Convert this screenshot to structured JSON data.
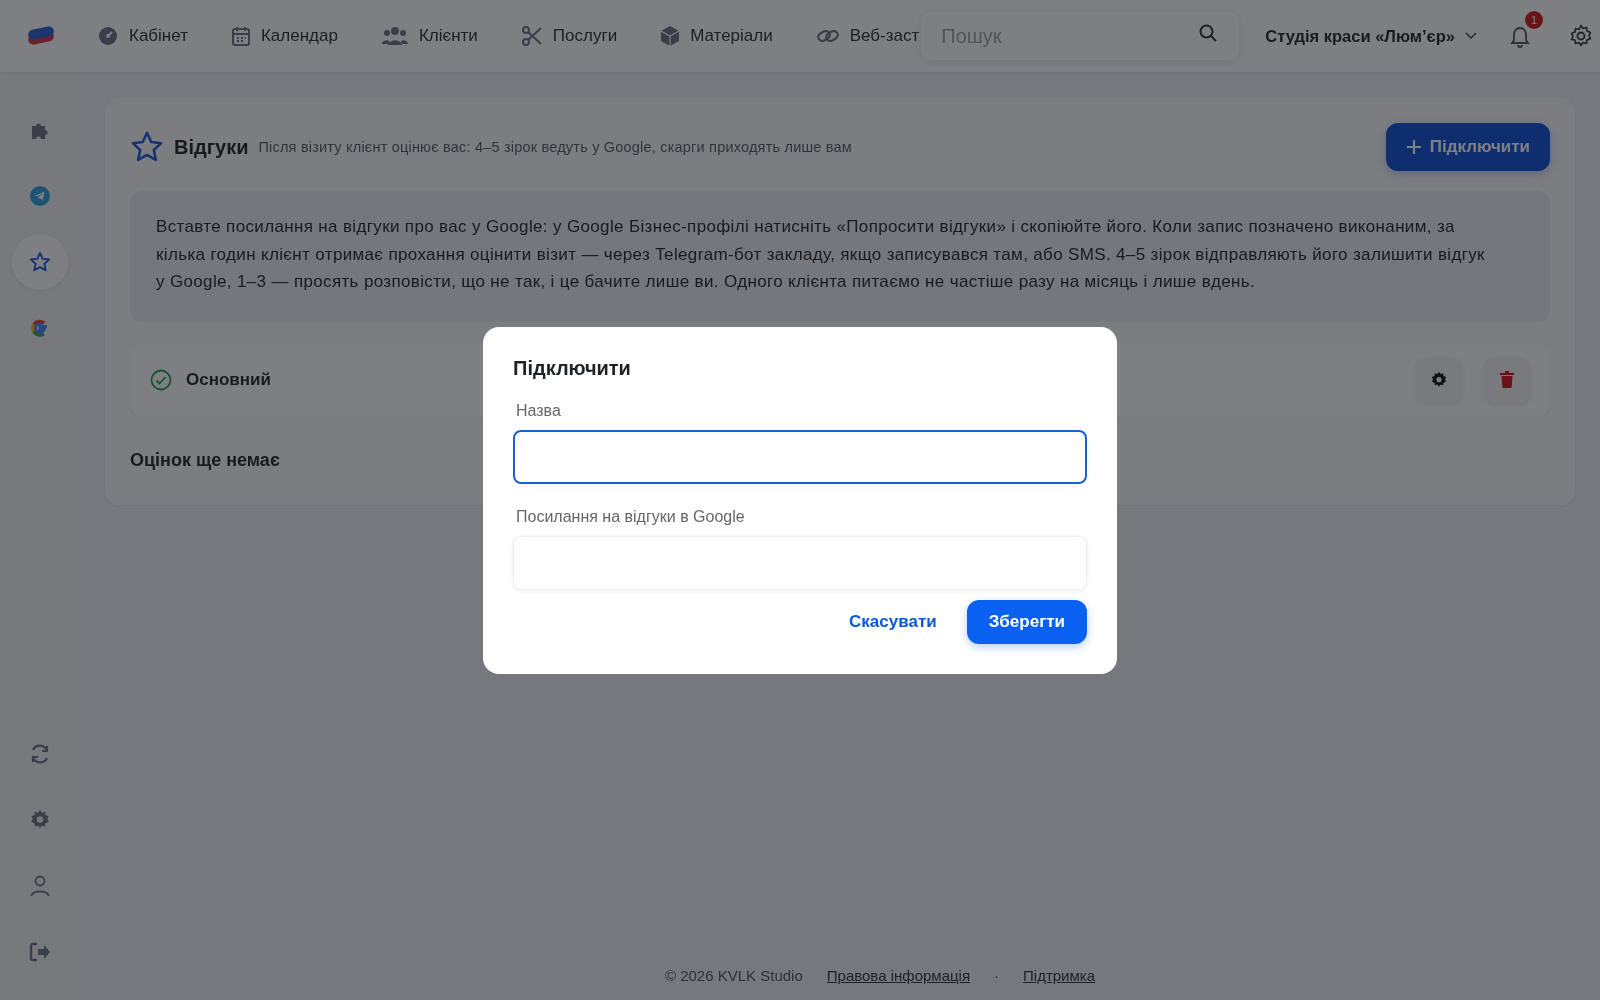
{
  "topbar": {
    "nav": [
      {
        "label": "Кабінет"
      },
      {
        "label": "Календар"
      },
      {
        "label": "Клієнти"
      },
      {
        "label": "Послуги"
      },
      {
        "label": "Матеріали"
      },
      {
        "label": "Веб-заст"
      }
    ],
    "search": {
      "placeholder": "Пошук"
    },
    "studio_menu": {
      "label": "Студія краси «Люм’єр»"
    },
    "notifications": {
      "count": "1"
    }
  },
  "sidebar": {
    "items": [
      {
        "selected": false
      },
      {
        "selected": false
      },
      {
        "selected": true
      },
      {
        "selected": false
      }
    ]
  },
  "page": {
    "title": "Відгуки",
    "subtitle": "Після візиту клієнт оцінює вас: 4–5 зірок ведуть у Google, скарги приходять лише вам",
    "connect_button": "Підключити",
    "info": "Вставте посилання на відгуки про вас у Google: у Google Бізнес-профілі натисніть «Попросити відгуки» і скопіюйте його. Коли запис позначено виконаним, за кілька годин клієнт отримає прохання оцінити візит — через Telegram-бот закладу, якщо записувався там, або SMS. 4–5 зірок відправляють його залишити відгук у Google, 1–3 — просять розповісти, що не так, і це бачите лише ви. Одного клієнта питаємо не частіше разу на місяць і лише вдень.",
    "integrations": [
      {
        "name": "Основний",
        "active": true
      }
    ],
    "empty_text": "Оцінок ще немає"
  },
  "footer": {
    "copyright": "© 2026 KVLK Studio",
    "links": [
      "Правова інформація",
      "Підтримка"
    ],
    "separator": "·"
  },
  "dialog": {
    "title": "Підключити",
    "fields": [
      {
        "label": "Назва",
        "focused": true
      },
      {
        "label": "Посилання на відгуки в Google",
        "focused": false
      }
    ],
    "buttons": [
      {
        "label": "Скасувати",
        "kind": "secondary"
      },
      {
        "label": "Зберегти",
        "kind": "primary"
      }
    ]
  }
}
